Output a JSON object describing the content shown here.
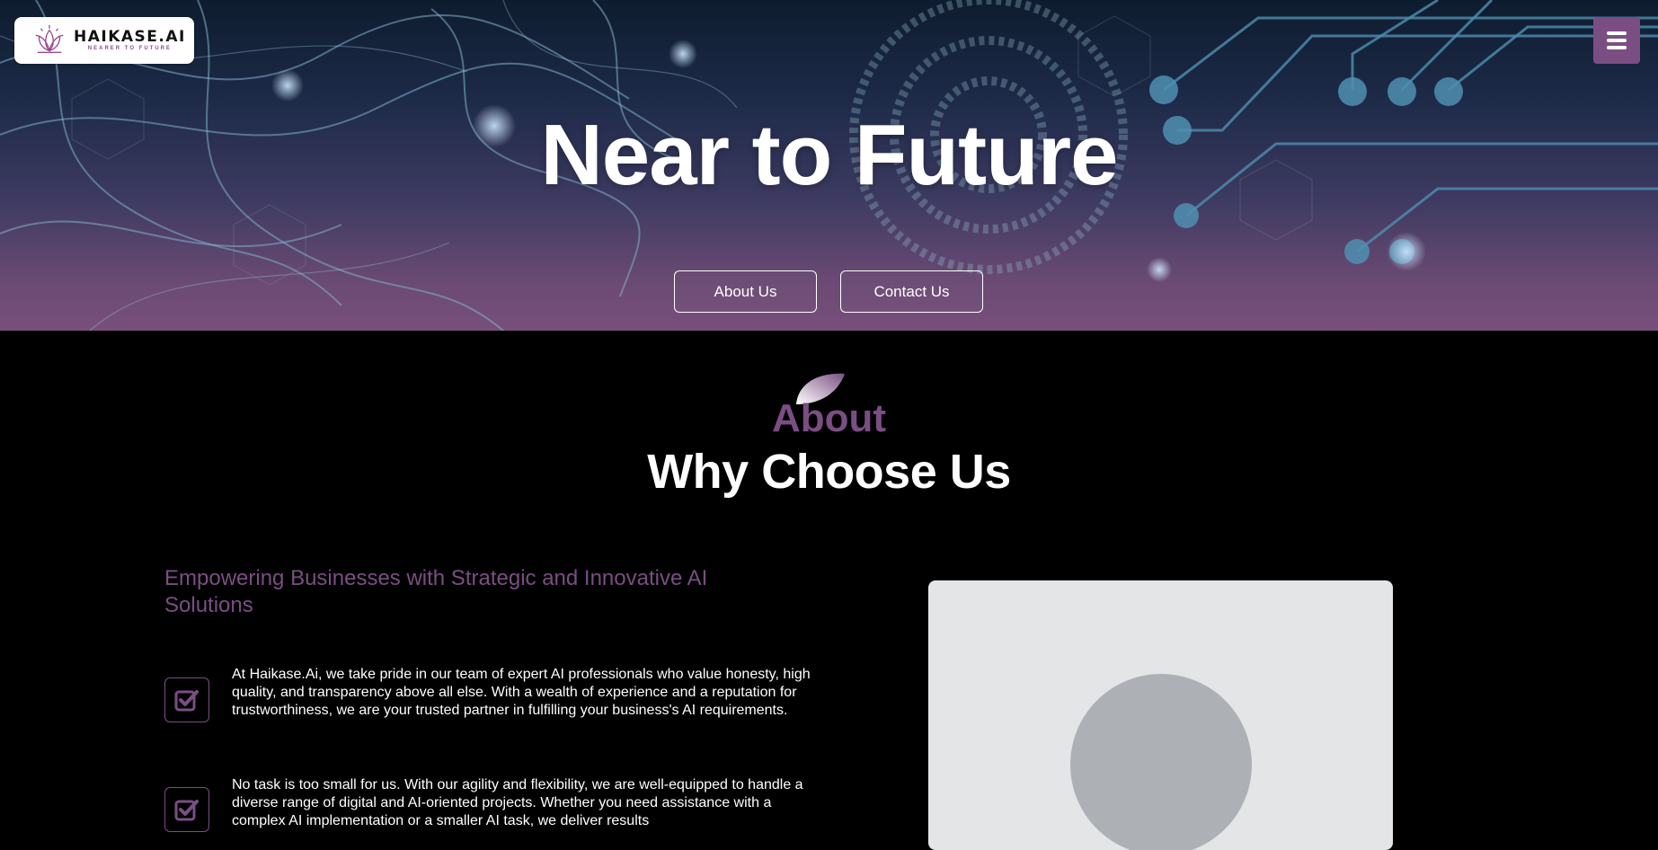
{
  "brand": {
    "name": "HAIKASE.AI",
    "tagline": "NEARER TO FUTURE",
    "logo_icon": "lotus-mark-icon",
    "accent_color": "#7a4e83"
  },
  "nav": {
    "menu_icon": "hamburger-menu-icon"
  },
  "hero": {
    "title": "Near to Future",
    "buttons": {
      "about": "About Us",
      "contact": "Contact Us"
    }
  },
  "about": {
    "label": "About",
    "title": "Why Choose Us",
    "subheading": "Empowering Businesses with Strategic and Innovative AI Solutions",
    "features": [
      {
        "icon": "checkbox-checked-icon",
        "text": "At Haikase.Ai, we take pride in our team of expert AI professionals who value honesty, high quality, and transparency above all else. With a wealth of experience and a reputation for trustworthiness, we are your trusted partner in fulfilling your business's AI requirements."
      },
      {
        "icon": "checkbox-checked-icon",
        "text": "No task is too small for us. With our agility and flexibility, we are well-equipped to handle a diverse range of digital and AI-oriented projects. Whether you need assistance with a complex AI implementation or a smaller AI task, we deliver results"
      }
    ],
    "image_placeholder_icon": "image-placeholder-icon"
  }
}
